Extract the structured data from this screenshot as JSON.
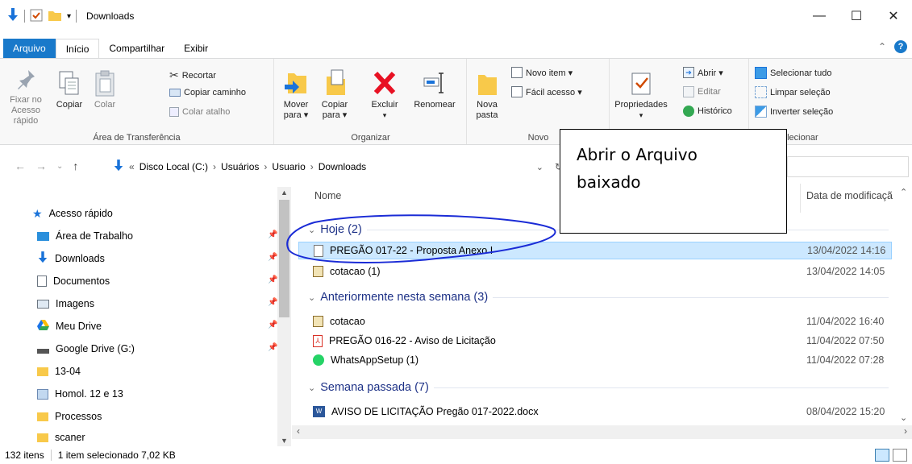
{
  "window": {
    "title": "Downloads"
  },
  "tabs": {
    "file": "Arquivo",
    "home": "Início",
    "share": "Compartilhar",
    "view": "Exibir"
  },
  "ribbon": {
    "clipboard": {
      "label": "Área de Transferência",
      "pin": "Fixar no Acesso rápido",
      "copy": "Copiar",
      "paste": "Colar",
      "cut": "Recortar",
      "copy_path": "Copiar caminho",
      "paste_shortcut": "Colar atalho"
    },
    "organize": {
      "label": "Organizar",
      "move_to": "Mover para ▾",
      "copy_to": "Copiar para ▾",
      "delete": "Excluir",
      "rename": "Renomear"
    },
    "new": {
      "label": "Novo",
      "new_folder": "Nova pasta",
      "new_item": "Novo item ▾",
      "easy_access": "Fácil acesso ▾"
    },
    "open": {
      "properties": "Propriedades",
      "open": "Abrir ▾",
      "edit": "Editar",
      "history": "Histórico"
    },
    "select": {
      "label": "elecionar",
      "select_all": "Selecionar tudo",
      "select_none": "Limpar seleção",
      "invert": "Inverter seleção"
    }
  },
  "address": {
    "prefix": "«",
    "crumbs": [
      "Disco Local (C:)",
      "Usuários",
      "Usuario",
      "Downloads"
    ]
  },
  "nav": {
    "items": [
      {
        "label": "Acesso rápido",
        "icon": "star-icon",
        "pinned": false
      },
      {
        "label": "Área de Trabalho",
        "icon": "desktop-icon",
        "pinned": true
      },
      {
        "label": "Downloads",
        "icon": "download-icon",
        "pinned": true
      },
      {
        "label": "Documentos",
        "icon": "documents-icon",
        "pinned": true
      },
      {
        "label": "Imagens",
        "icon": "images-icon",
        "pinned": true
      },
      {
        "label": "Meu Drive",
        "icon": "google-drive-icon",
        "pinned": true
      },
      {
        "label": "Google Drive (G:)",
        "icon": "drive-icon",
        "pinned": true
      },
      {
        "label": "13-04",
        "icon": "folder-icon",
        "pinned": false
      },
      {
        "label": "Homol. 12 e 13",
        "icon": "folder-icon",
        "pinned": false
      },
      {
        "label": "Processos",
        "icon": "folder-icon",
        "pinned": false
      },
      {
        "label": "scaner",
        "icon": "folder-icon",
        "pinned": false
      }
    ]
  },
  "list": {
    "col_name": "Nome",
    "col_date": "Data de modificaçã",
    "groups": [
      {
        "label": "Hoje (2)",
        "files": [
          {
            "name": "PREGÃO 017-22 - Proposta Anexo I",
            "date": "13/04/2022 14:16",
            "icon": "file-icon",
            "selected": true
          },
          {
            "name": "cotacao (1)",
            "date": "13/04/2022 14:05",
            "icon": "script-icon",
            "selected": false
          }
        ]
      },
      {
        "label": "Anteriormente nesta semana (3)",
        "files": [
          {
            "name": "cotacao",
            "date": "11/04/2022 16:40",
            "icon": "script-icon",
            "selected": false
          },
          {
            "name": "PREGÃO 016-22 - Aviso de Licitação",
            "date": "11/04/2022 07:50",
            "icon": "pdf-icon",
            "selected": false
          },
          {
            "name": "WhatsAppSetup (1)",
            "date": "11/04/2022 07:28",
            "icon": "whatsapp-icon",
            "selected": false
          }
        ]
      },
      {
        "label": "Semana passada (7)",
        "files": [
          {
            "name": "AVISO DE LICITAÇÃO Pregão 017-2022.docx",
            "date": "08/04/2022 15:20",
            "icon": "word-icon",
            "selected": false
          }
        ]
      }
    ]
  },
  "status": {
    "count": "132 itens",
    "selection": "1 item selecionado  7,02 KB"
  },
  "annotation": {
    "line1": "Abrir o Arquivo",
    "line2": "baixado"
  },
  "colors": {
    "accent": "#1979ca",
    "selection": "#cce8ff",
    "group_header": "#1e3287",
    "annotation_ellipse": "#1a2bd6"
  }
}
